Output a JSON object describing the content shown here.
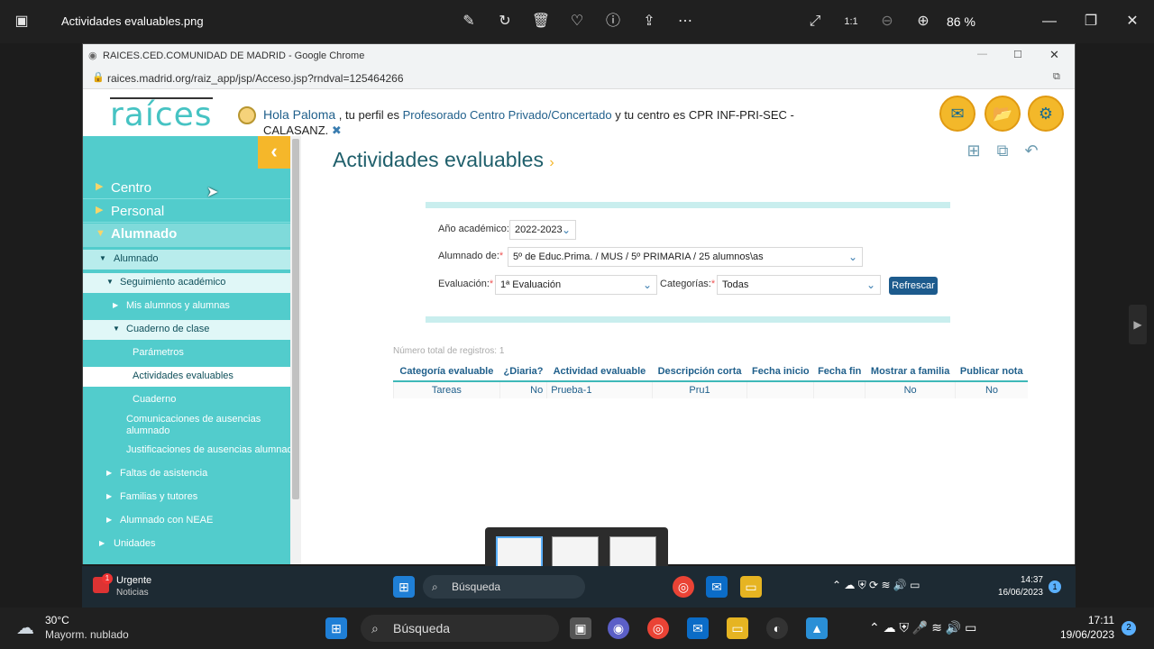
{
  "viewer": {
    "title": "Actividades evaluables.png",
    "zoom": "86 %"
  },
  "browser": {
    "window_title": "RAICES.CED.COMUNIDAD DE MADRID - Google Chrome",
    "url": "raices.madrid.org/raiz_app/jsp/Acceso.jsp?rndval=125464266"
  },
  "header": {
    "logo": "raíces",
    "hello": "Hola Paloma",
    "profile_text": ", tu perfil es",
    "profile": "Profesorado Centro Privado/Concertado",
    "center_text": "y tu centro es CPR INF-PRI-SEC - CALASANZ."
  },
  "sidebar": {
    "top": [
      {
        "label": "Centro"
      },
      {
        "label": "Personal"
      },
      {
        "label": "Alumnado"
      }
    ],
    "tree": [
      {
        "label": "Alumnado"
      },
      {
        "label": "Seguimiento académico"
      },
      {
        "label": "Mis alumnos y alumnas"
      },
      {
        "label": "Cuaderno de clase"
      },
      {
        "label": "Parámetros"
      },
      {
        "label": "Actividades evaluables"
      },
      {
        "label": "Cuaderno"
      },
      {
        "label": "Comunicaciones de ausencias alumnado"
      },
      {
        "label": "Justificaciones de ausencias alumnado"
      },
      {
        "label": "Faltas de asistencia"
      },
      {
        "label": "Familias y tutores"
      },
      {
        "label": "Alumnado con NEAE"
      },
      {
        "label": "Unidades"
      }
    ]
  },
  "main": {
    "title": "Actividades evaluables",
    "form": {
      "year_label": "Año académico:",
      "year_value": "2022-2023",
      "students_label": "Alumnado de:",
      "students_value": "5º de Educ.Prima. / MUS / 5º PRIMARIA / 25 alumnos\\as",
      "eval_label": "Evaluación:",
      "eval_value": "1ª Evaluación",
      "categories_label": "Categorías:",
      "categories_value": "Todas",
      "refresh_label": "Refrescar"
    },
    "total_records": "Número total de registros: 1",
    "table": {
      "headers": [
        "Categoría evaluable",
        "¿Diaria?",
        "Actividad evaluable",
        "Descripción corta",
        "Fecha inicio",
        "Fecha fin",
        "Mostrar a familia",
        "Publicar nota"
      ],
      "rows": [
        [
          "Tareas",
          "No",
          "Prueba-1",
          "Pru1",
          "",
          "",
          "No",
          "No"
        ]
      ]
    }
  },
  "inner_taskbar": {
    "news_badge": "1",
    "news_title": "Urgente",
    "news_sub": "Noticias",
    "search": "Búsqueda",
    "time": "14:37",
    "date": "16/06/2023",
    "notif": "1"
  },
  "outer_taskbar": {
    "temp": "30°C",
    "weather": "Mayorm. nublado",
    "search": "Búsqueda",
    "time": "17:11",
    "date": "19/06/2023",
    "notif": "2"
  }
}
